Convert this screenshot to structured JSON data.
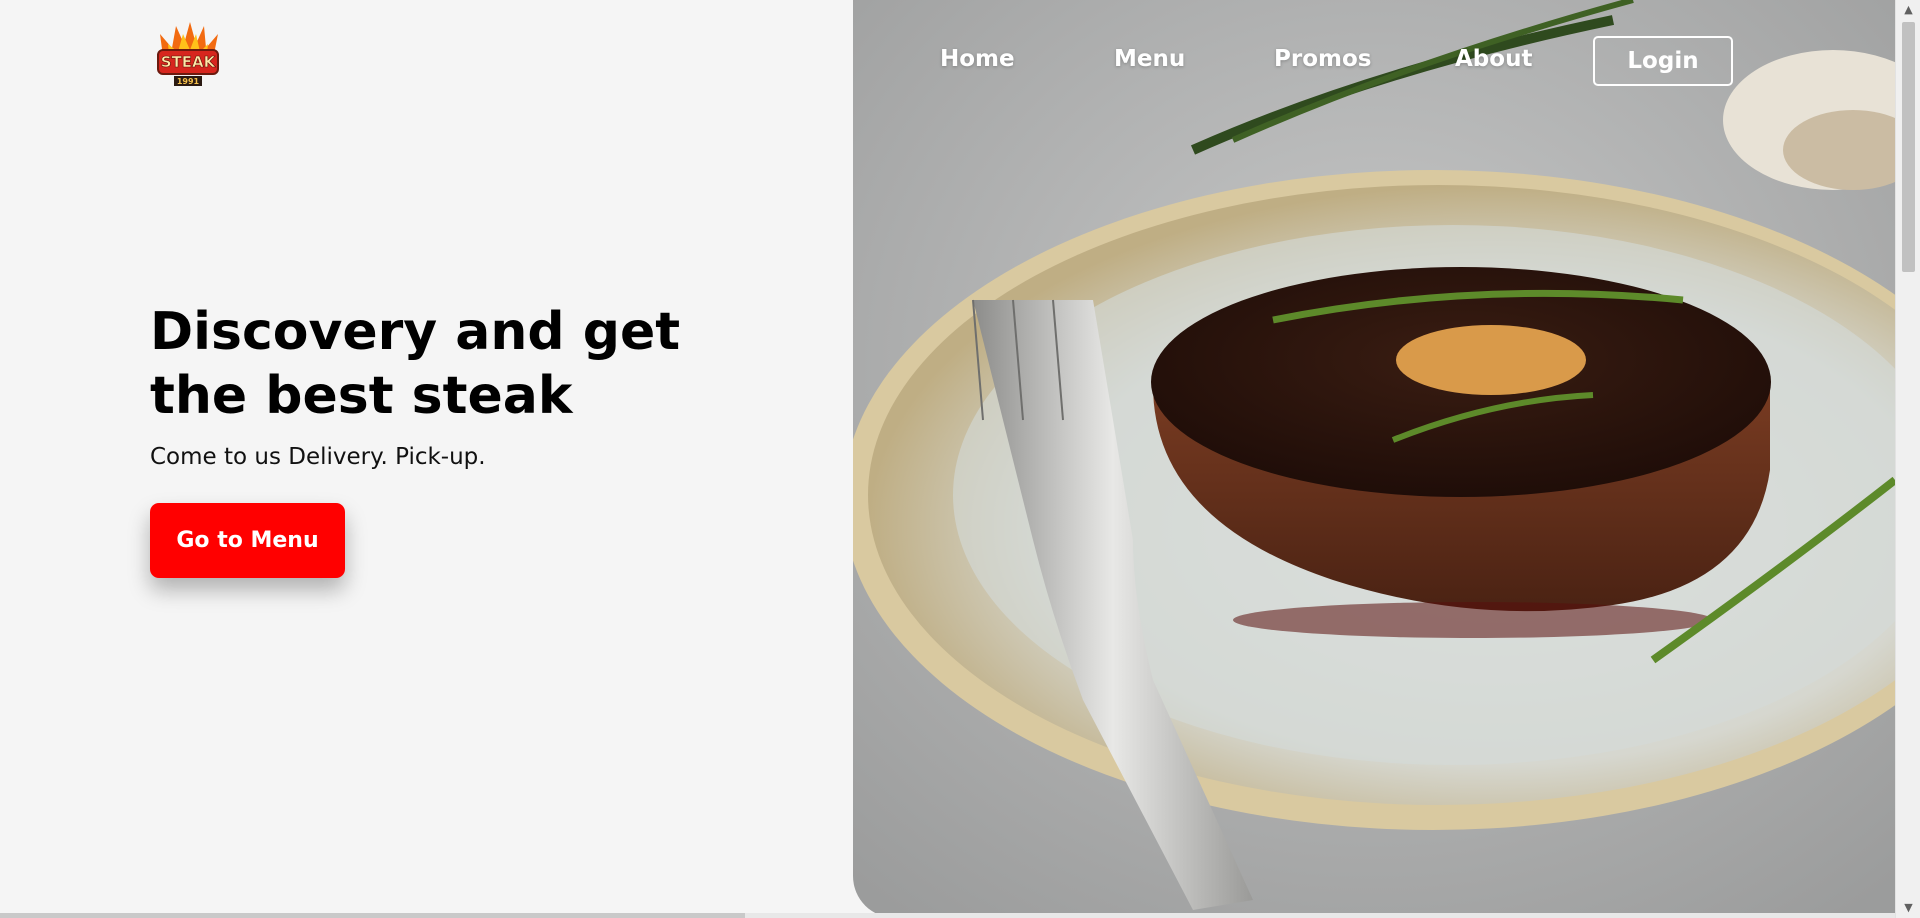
{
  "brand": {
    "logo_text": "STEAK",
    "logo_year": "1991"
  },
  "nav": {
    "links": [
      {
        "label": "Home"
      },
      {
        "label": "Menu"
      },
      {
        "label": "Promos"
      },
      {
        "label": "About"
      }
    ],
    "login_label": "Login"
  },
  "hero": {
    "title_line1": "Discovery and get",
    "title_line2": "the best steak",
    "subtitle": "Come to us Delivery. Pick-up.",
    "cta_label": "Go to Menu"
  },
  "colors": {
    "accent": "#ff0000",
    "background": "#f5f5f5",
    "text": "#000000"
  },
  "icons": {
    "scroll_up": "chevron-up-icon",
    "scroll_down": "chevron-down-icon"
  }
}
